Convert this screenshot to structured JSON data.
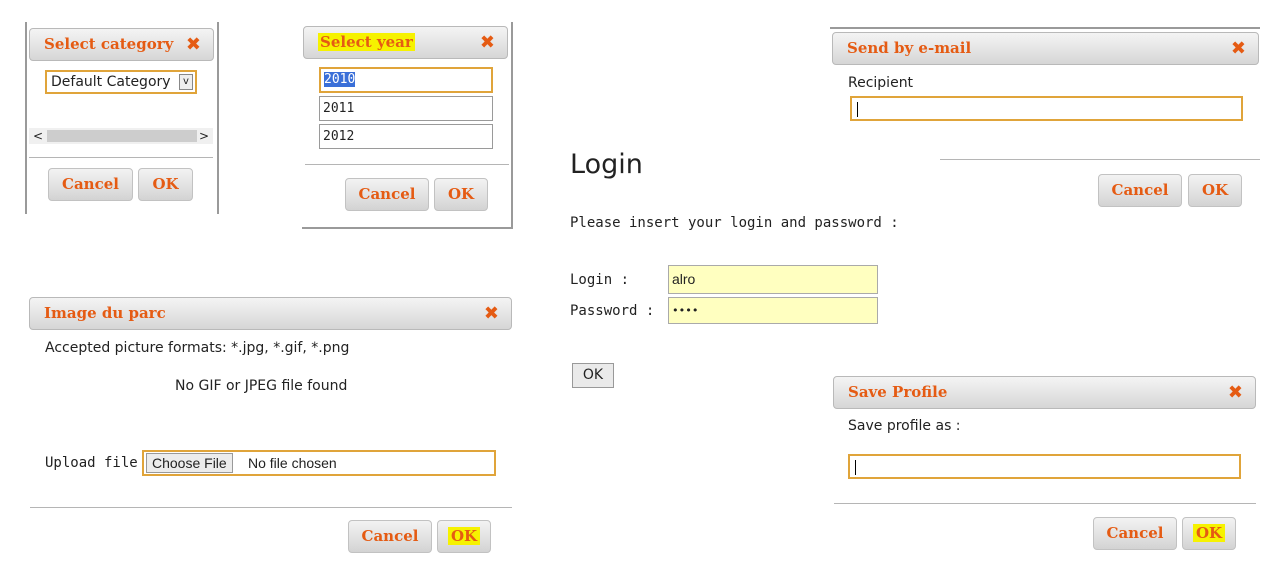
{
  "select_category": {
    "title": "Select category",
    "close": "✖",
    "selected": "Default Category",
    "dropdown_arrow": "v",
    "scroll_left": "<",
    "scroll_right": ">",
    "cancel": "Cancel",
    "ok": "OK"
  },
  "select_year": {
    "title": "Select year",
    "close": "✖",
    "years": [
      "2010",
      "2011",
      "2012"
    ],
    "cancel": "Cancel",
    "ok": "OK"
  },
  "send_email": {
    "title": "Send by e-mail",
    "close": "✖",
    "recipient_label": "Recipient",
    "recipient_value": "",
    "cancel": "Cancel",
    "ok": "OK"
  },
  "login": {
    "heading": "Login",
    "instructions": "Please insert your login and password :",
    "login_label": "Login :",
    "login_value": "alro",
    "password_label": "Password :",
    "password_value": "••••",
    "ok": "OK"
  },
  "image_parc": {
    "title": "Image du parc",
    "close": "✖",
    "formats": "Accepted picture formats: *.jpg, *.gif, *.png",
    "no_file": "No GIF or JPEG file found",
    "upload_label": "Upload file :",
    "choose_file": "Choose File",
    "no_file_chosen": "No file chosen",
    "cancel": "Cancel",
    "ok": "OK"
  },
  "save_profile": {
    "title": "Save Profile",
    "close": "✖",
    "label": "Save profile as :",
    "value": "",
    "cancel": "Cancel",
    "ok": "OK"
  },
  "colors": {
    "accent": "#e55b13",
    "highlight": "#f6f200",
    "input_fill": "#ffffc0"
  }
}
